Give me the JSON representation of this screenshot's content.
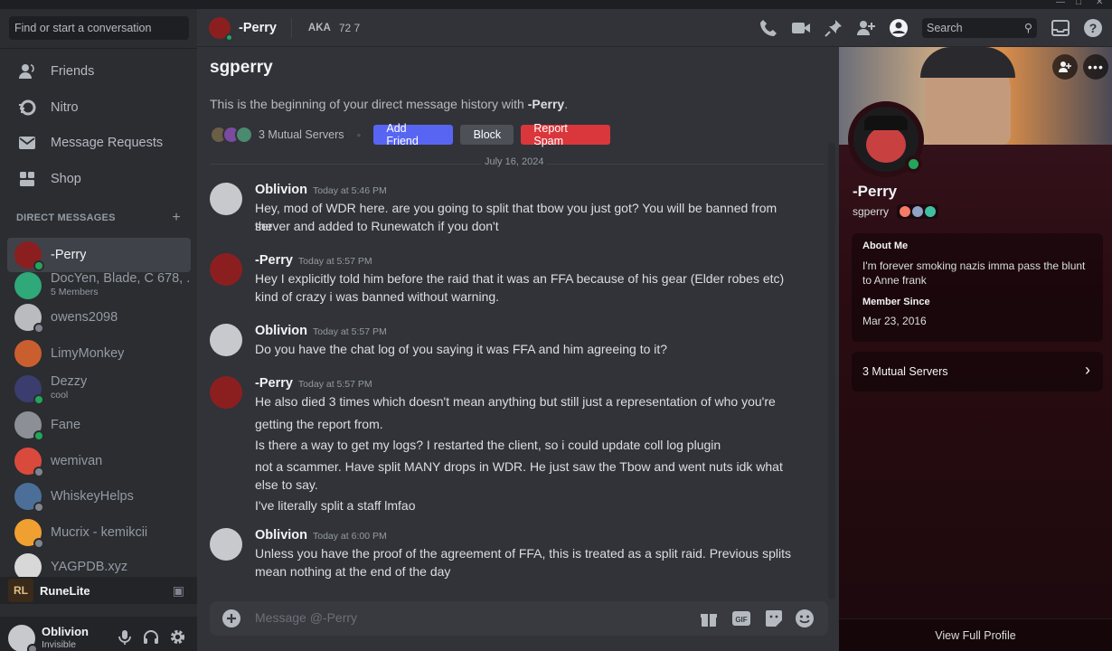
{
  "sidebar": {
    "search_placeholder": "Find or start a conversation",
    "nav": [
      {
        "label": "Friends",
        "icon": "friends-icon"
      },
      {
        "label": "Nitro",
        "icon": "nitro-icon"
      },
      {
        "label": "Message Requests",
        "icon": "envelope-icon"
      },
      {
        "label": "Shop",
        "icon": "shop-icon"
      }
    ],
    "dm_header": "DIRECT MESSAGES",
    "dms": [
      {
        "name": "-Perry",
        "sub": "",
        "status": "online",
        "color": "#8b1f1f"
      },
      {
        "name": "DocYen, Blade, C 678, ...",
        "sub": "5 Members",
        "status": "",
        "color": "#2fa87a"
      },
      {
        "name": "owens2098",
        "sub": "",
        "status": "offline",
        "color": "#b9bbbf"
      },
      {
        "name": "LimyMonkey",
        "sub": "",
        "status": "",
        "color": "#c95f2f"
      },
      {
        "name": "Dezzy",
        "sub": "cool",
        "status": "online",
        "color": "#3b3d6e"
      },
      {
        "name": "Fane",
        "sub": "",
        "status": "online",
        "color": "#8c8f96"
      },
      {
        "name": "wemivan",
        "sub": "",
        "status": "offline",
        "color": "#d94a3d"
      },
      {
        "name": "WhiskeyHelps",
        "sub": "",
        "status": "offline",
        "color": "#4c6f99"
      },
      {
        "name": "Mucrix - kemikcii",
        "sub": "",
        "status": "offline",
        "color": "#f0a030"
      },
      {
        "name": "YAGPDB.xyz",
        "sub": "",
        "status": "",
        "color": "#d8d8d8"
      }
    ],
    "runelite": "RuneLite",
    "user": {
      "name": "Oblivion",
      "status": "Invisible"
    }
  },
  "header": {
    "name": "-Perry",
    "aka_label": "AKA",
    "aka_value": "72 7",
    "search_placeholder": "Search"
  },
  "chat": {
    "title": "sgperry",
    "intro_prefix": "This is the beginning of your direct message history with ",
    "intro_name": "-Perry",
    "intro_suffix": ".",
    "mutual": "3 Mutual Servers",
    "buttons": {
      "add_friend": "Add Friend",
      "block": "Block",
      "report": "Report Spam"
    },
    "date": "July 16, 2024",
    "messages": [
      {
        "author": "Oblivion",
        "time": "Today at 5:46 PM",
        "lines": [
          "Hey, mod of WDR here. are you going to split that tbow you just got? You will be banned from the",
          "server and added to Runewatch if you don't"
        ]
      },
      {
        "author": "-Perry",
        "time": "Today at 5:57 PM",
        "lines": [
          "Hey I explicitly told him before the raid that it was an FFA because of his gear (Elder robes etc)",
          "kind of crazy i was banned without warning."
        ]
      },
      {
        "author": "Oblivion",
        "time": "Today at 5:57 PM",
        "lines": [
          "Do you have the chat log of you saying it was FFA and him agreeing to it?"
        ]
      },
      {
        "author": "-Perry",
        "time": "Today at 5:57 PM",
        "lines": [
          "He also died 3 times which doesn't mean anything but still just a representation of who you're",
          "getting the report from.",
          "Is there a way to get my logs? I restarted the client, so i could update coll log plugin",
          "not a scammer. Have split MANY drops in WDR. He just saw the Tbow and went nuts idk what",
          "else to say.",
          "I've literally split a staff lmfao"
        ]
      },
      {
        "author": "Oblivion",
        "time": "Today at 6:00 PM",
        "lines": [
          "Unless you have the proof of the agreement of FFA, this is treated as a split raid. Previous splits",
          "mean nothing at the end of the day"
        ]
      }
    ],
    "input_placeholder": "Message @-Perry"
  },
  "profile": {
    "display_name": "-Perry",
    "username": "sgperry",
    "about_title": "About Me",
    "about_text": "I'm forever smoking nazis imma pass the blunt to Anne frank",
    "member_title": "Member Since",
    "member_date": "Mar 23, 2016",
    "mutual_servers": "3 Mutual Servers",
    "footer": "View Full Profile"
  },
  "colors": {
    "blurple": "#5865f2",
    "red": "#da373c",
    "online": "#23a55a"
  }
}
